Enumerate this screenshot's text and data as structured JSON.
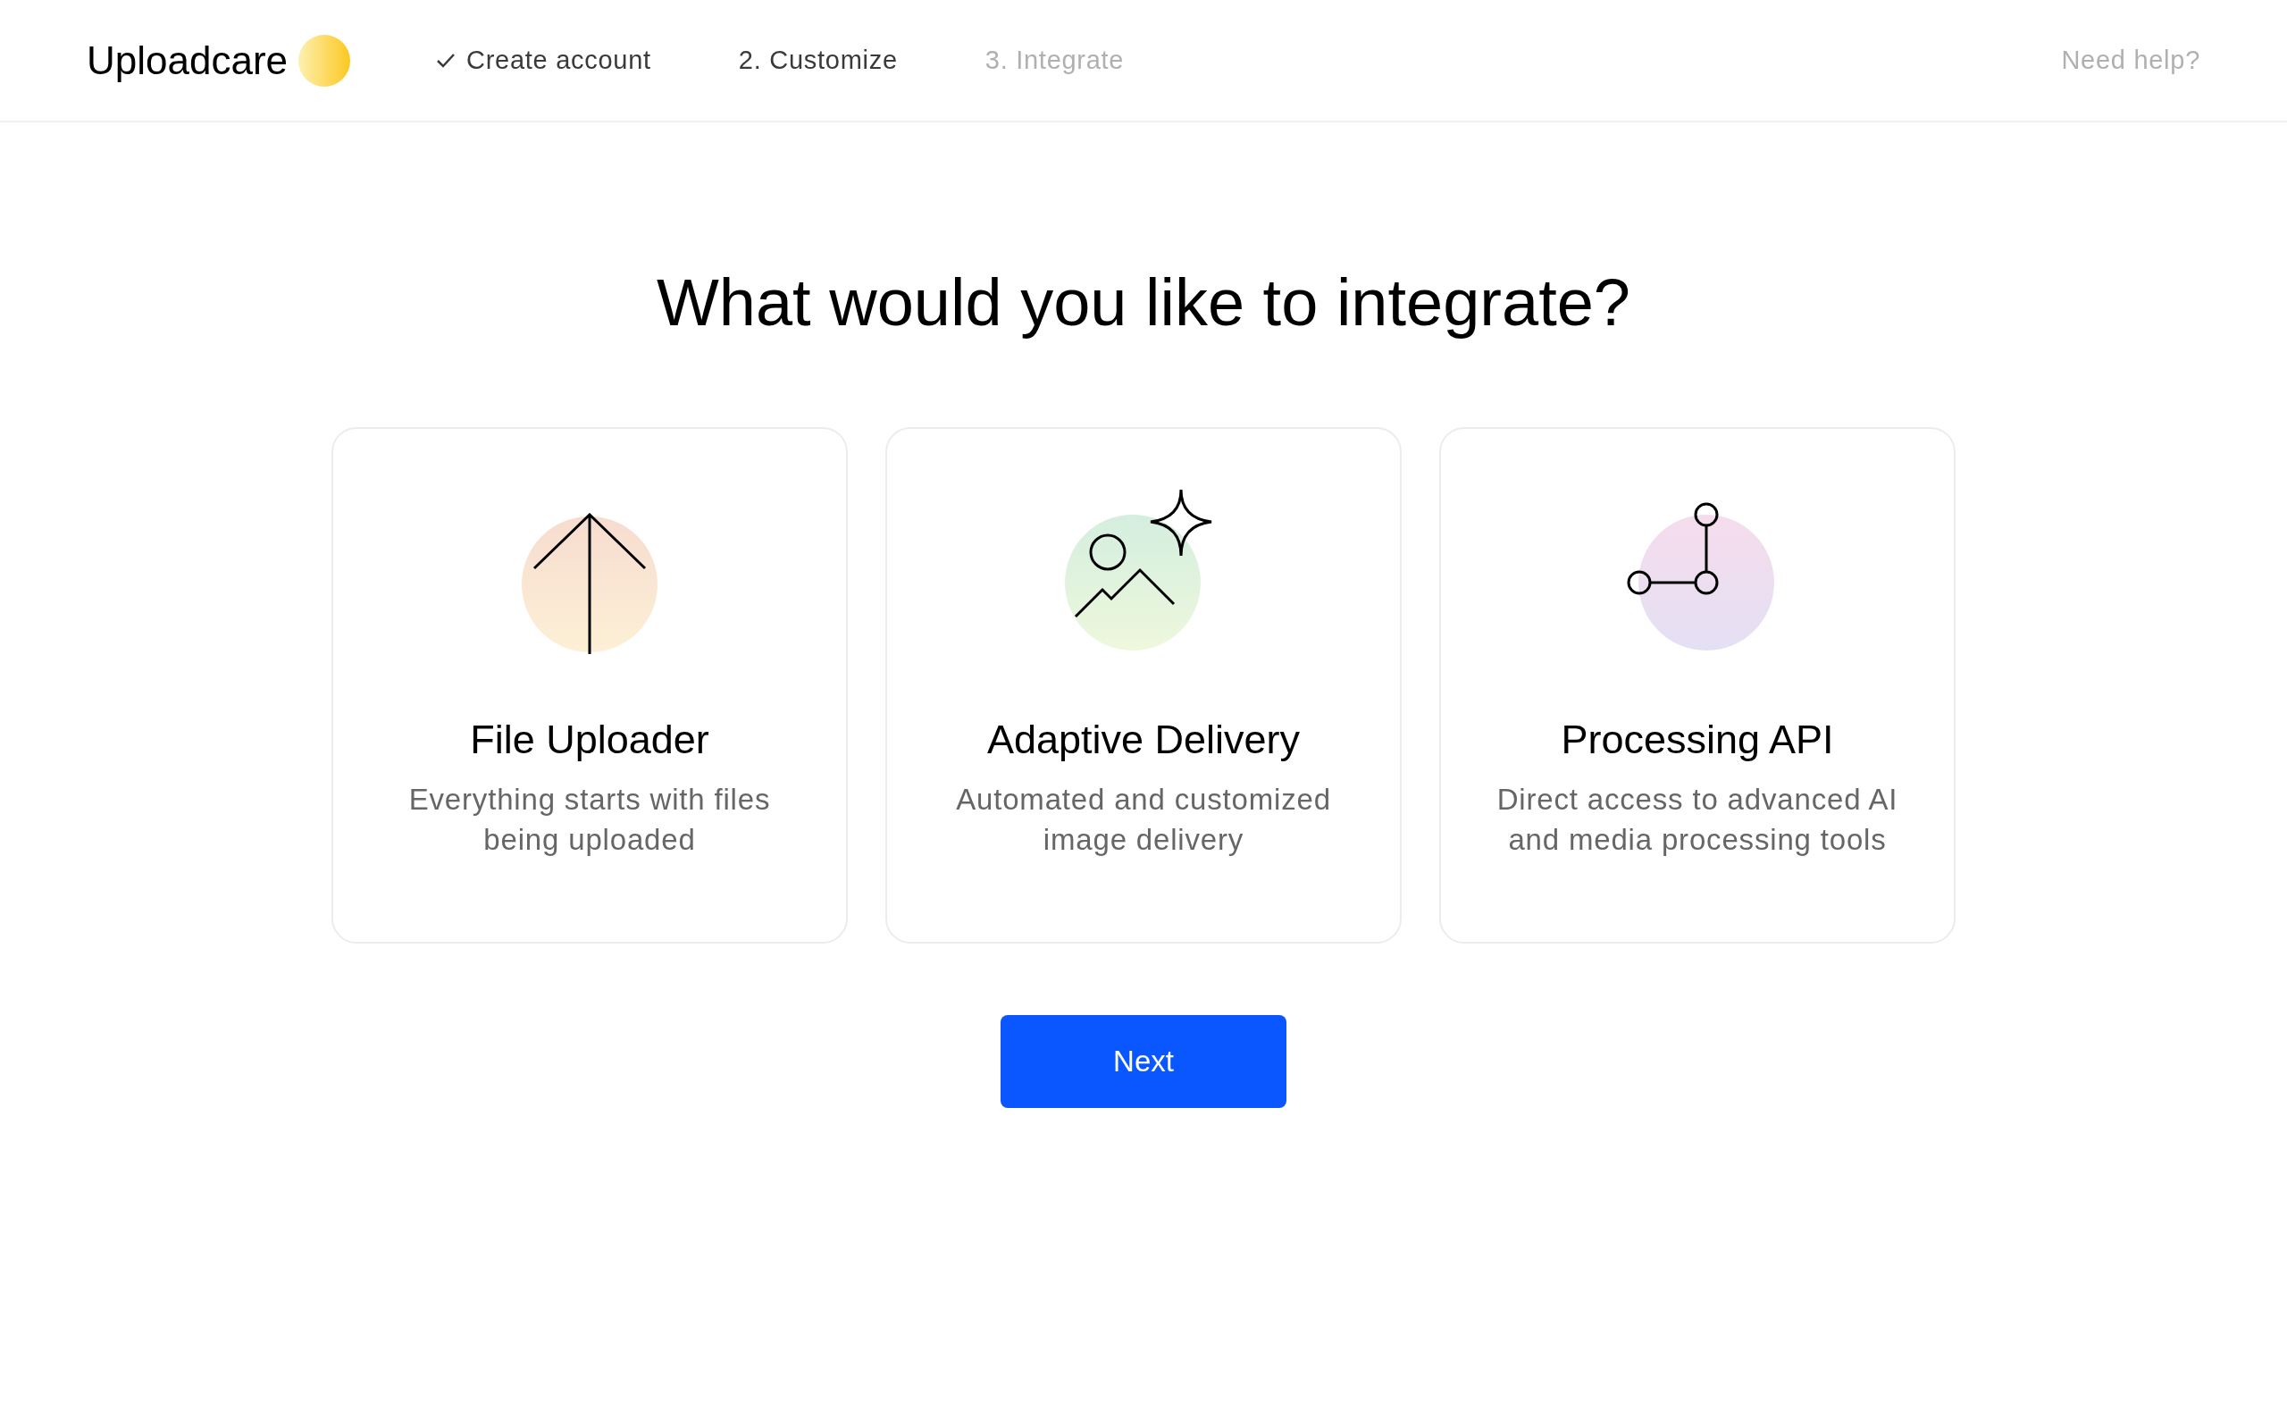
{
  "brand": {
    "name": "Uploadcare"
  },
  "steps": [
    {
      "label": "Create account",
      "done": true,
      "disabled": false
    },
    {
      "label": "2. Customize",
      "done": false,
      "disabled": false
    },
    {
      "label": "3. Integrate",
      "done": false,
      "disabled": true
    }
  ],
  "help_link": "Need help?",
  "heading": "What would you like to integrate?",
  "options": [
    {
      "kind": "uploader",
      "title": "File Uploader",
      "description": "Everything starts with files being uploaded"
    },
    {
      "kind": "delivery",
      "title": "Adaptive Delivery",
      "description": "Automated and customized image delivery"
    },
    {
      "kind": "processing",
      "title": "Processing API",
      "description": "Direct access to advanced AI and media processing tools"
    }
  ],
  "next_button": "Next"
}
